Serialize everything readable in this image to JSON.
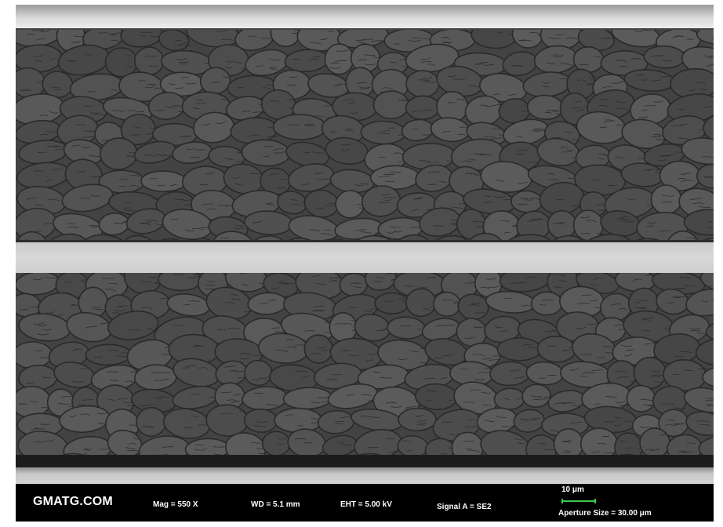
{
  "micrograph": {
    "colors": {
      "frame": "#ffffff",
      "layer": "#4a4a4a",
      "grain": "#535353",
      "grain_edge": "#2a2a2a",
      "foil": "#cfcfcf",
      "top_surface": "#b8b8b8",
      "info_bar": "#000000",
      "scale_bar": "#3fc94a"
    }
  },
  "info_bar": {
    "brand": "GMATG.COM",
    "mag": "Mag =   550 X",
    "wd": "WD =  5.1 mm",
    "eht": "EHT =  5.00 kV",
    "signal": "Signal A = SE2",
    "scale_label": "10 μm",
    "aperture": "Aperture Size = 30.00 μm"
  }
}
